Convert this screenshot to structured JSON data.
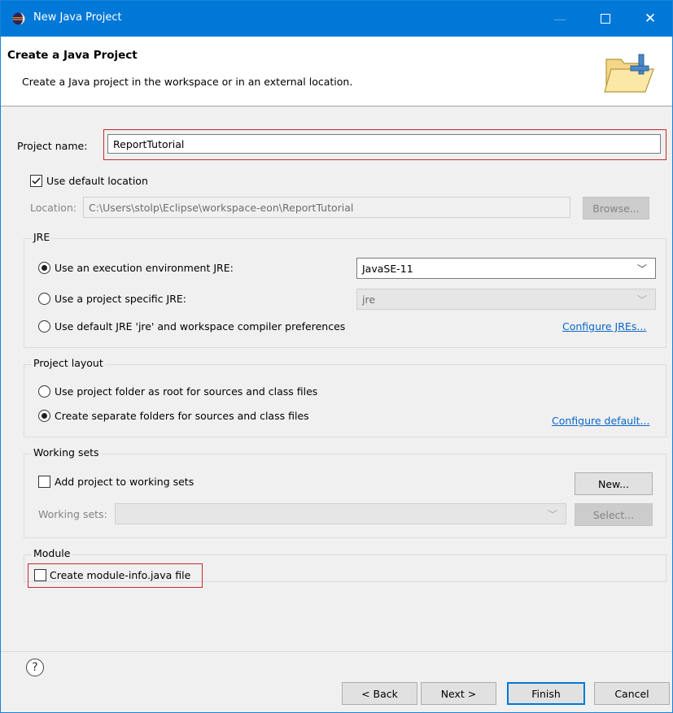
{
  "window": {
    "title": "New Java Project",
    "min_glyph": "—",
    "close_glyph": "✕"
  },
  "banner": {
    "title": "Create a Java Project",
    "description": "Create a Java project in the workspace or in an external location."
  },
  "project_name": {
    "label": "Project name:",
    "value": "ReportTutorial"
  },
  "location": {
    "use_default_label": "Use default location",
    "use_default_checked": true,
    "label": "Location:",
    "value": "C:\\Users\\stolp\\Eclipse\\workspace-eon\\ReportTutorial",
    "browse_label": "Browse..."
  },
  "jre": {
    "group_title": "JRE",
    "options": [
      {
        "label": "Use an execution environment JRE:",
        "selected": true,
        "combo_value": "JavaSE-11",
        "combo_enabled": true
      },
      {
        "label": "Use a project specific JRE:",
        "selected": false,
        "combo_value": "jre",
        "combo_enabled": false
      },
      {
        "label": "Use default JRE 'jre' and workspace compiler preferences",
        "selected": false
      }
    ],
    "configure_link": "Configure JREs..."
  },
  "project_layout": {
    "group_title": "Project layout",
    "options": [
      {
        "label": "Use project folder as root for sources and class files",
        "selected": false
      },
      {
        "label": "Create separate folders for sources and class files",
        "selected": true
      }
    ],
    "configure_link": "Configure default..."
  },
  "working_sets": {
    "group_title": "Working sets",
    "add_label": "Add project to working sets",
    "add_checked": false,
    "new_button": "New...",
    "sets_label": "Working sets:",
    "sets_value": "",
    "select_button": "Select..."
  },
  "module": {
    "group_title": "Module",
    "create_label": "Create module-info.java file",
    "create_checked": false
  },
  "footer": {
    "help_glyph": "?",
    "back_button": "< Back",
    "next_button": "Next >",
    "finish_button": "Finish",
    "cancel_button": "Cancel"
  },
  "colors": {
    "titlebar": "#0078d7",
    "highlight_outline": "#c42b2b",
    "link": "#0a66c8"
  }
}
